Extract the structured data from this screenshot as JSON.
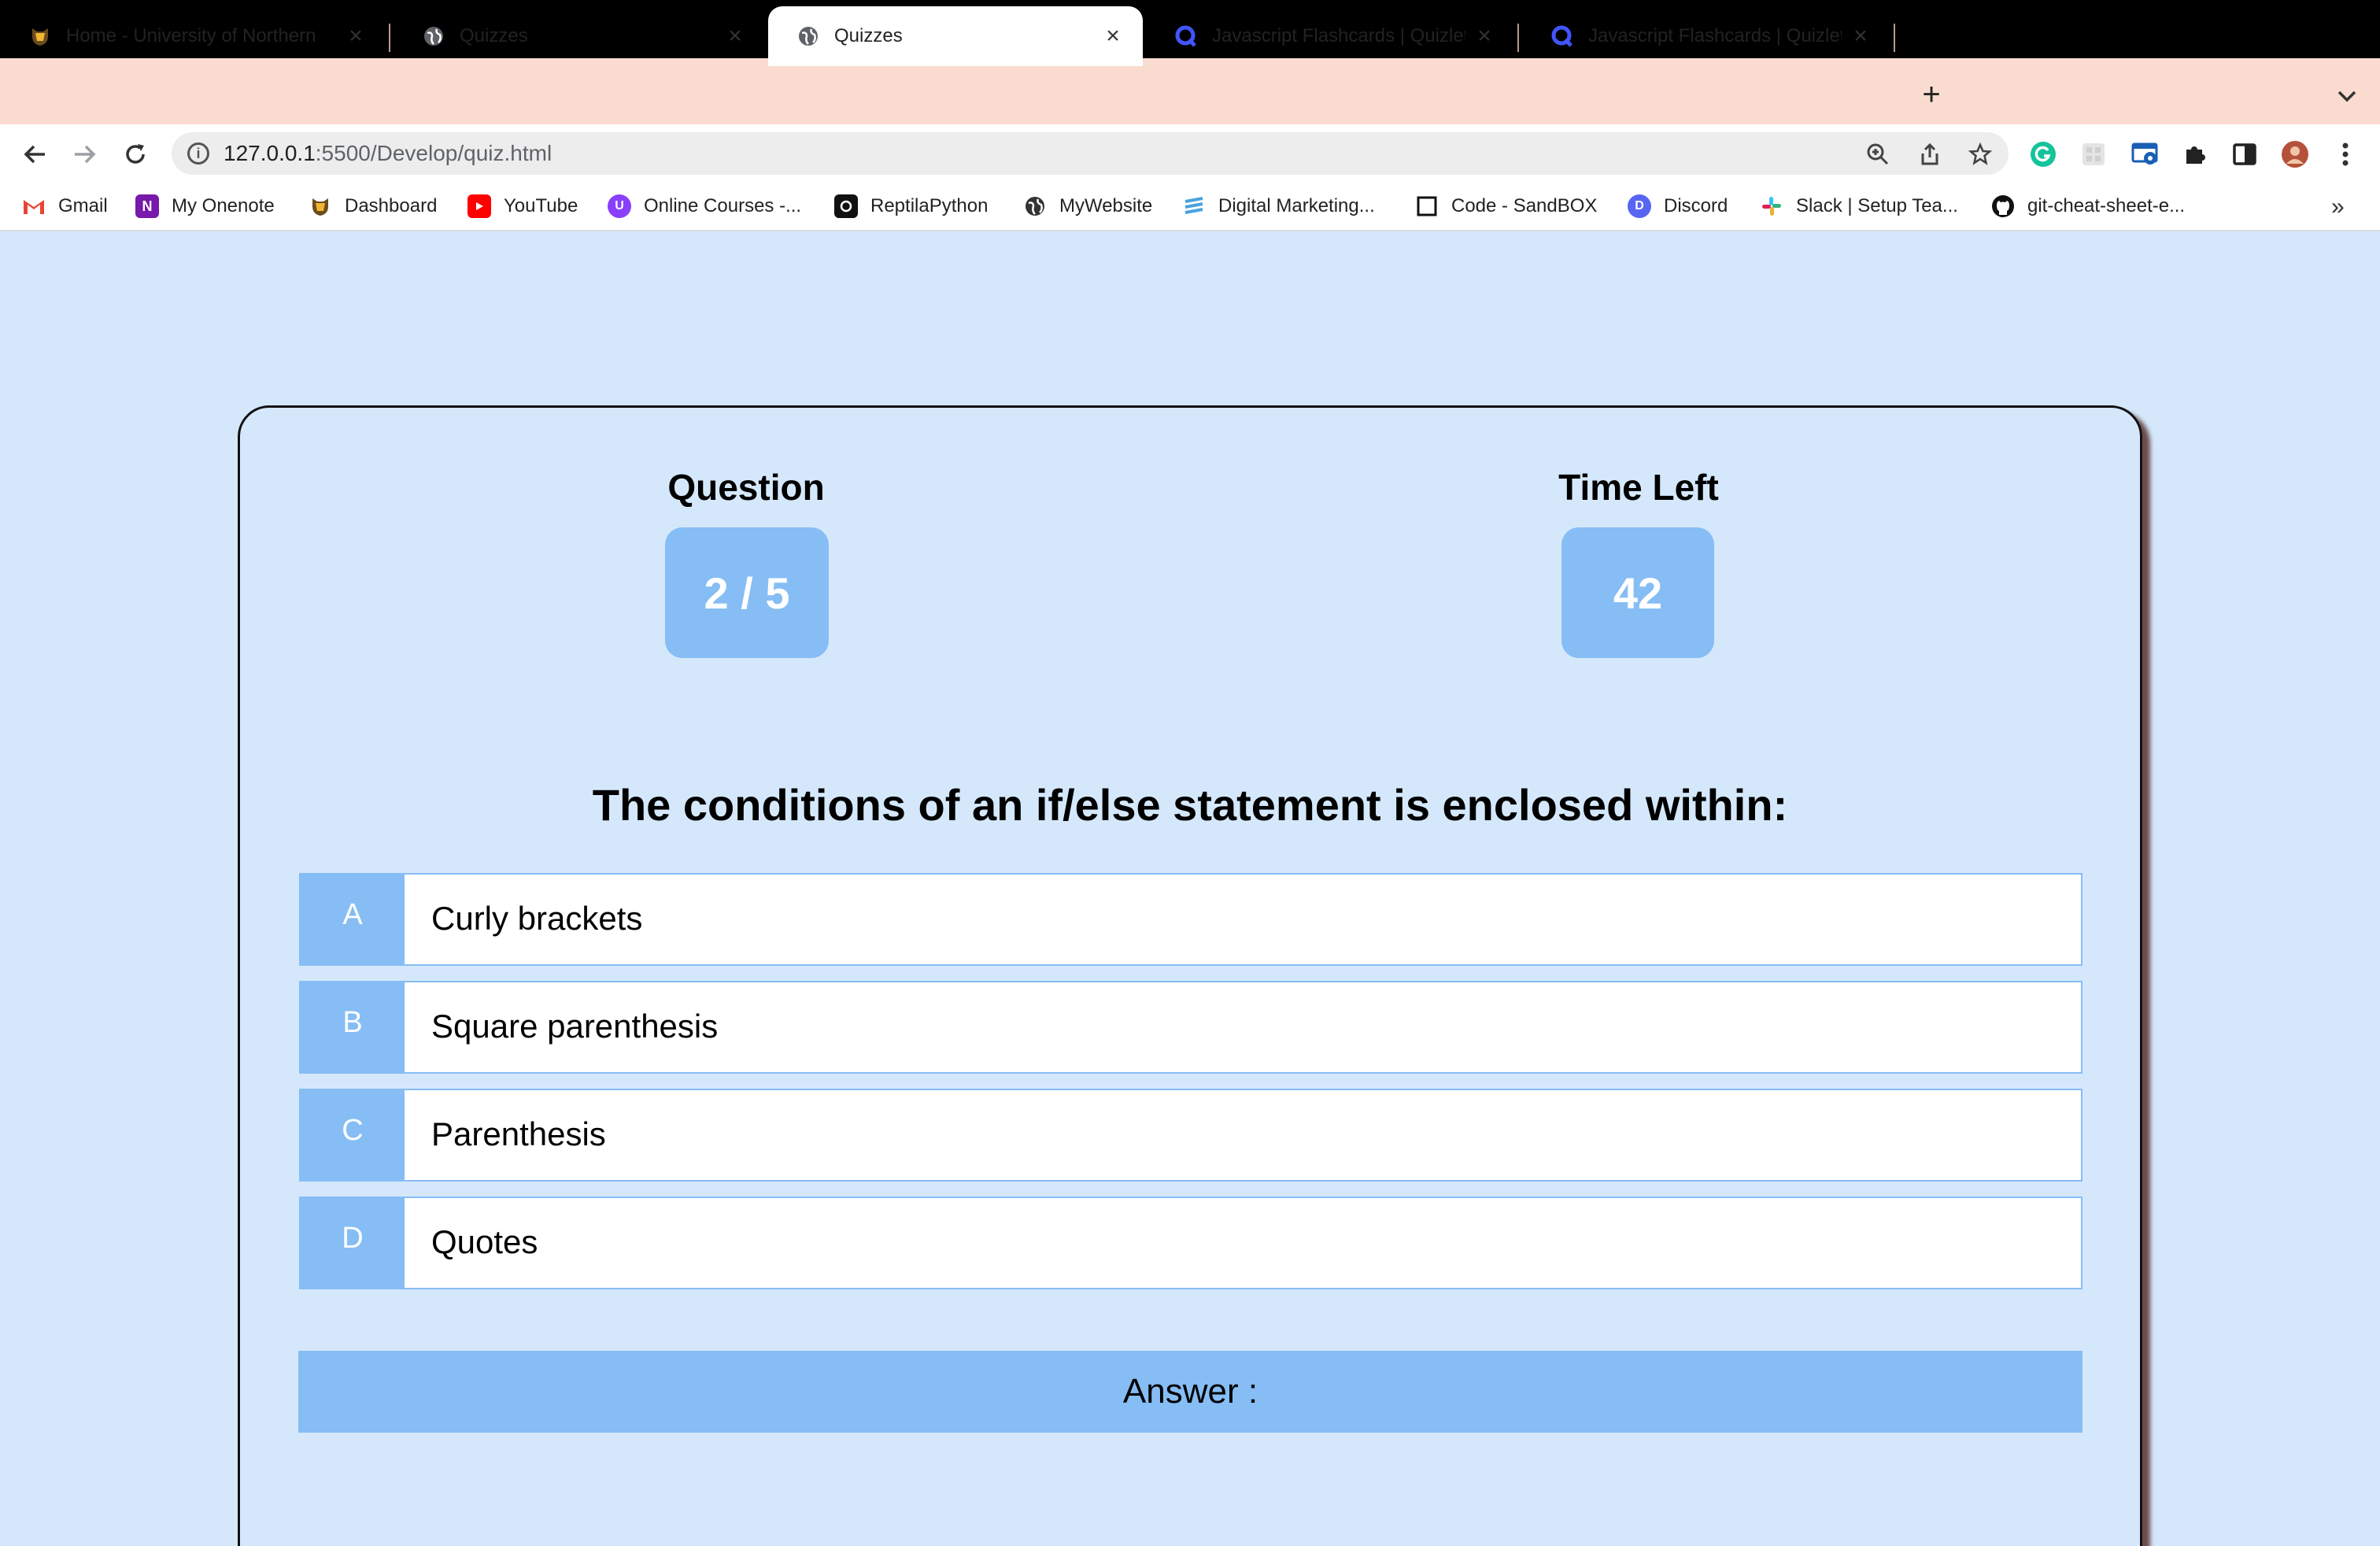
{
  "browser": {
    "tabs": [
      {
        "title": "Home - University of Northern",
        "favicon": "university-bear-icon"
      },
      {
        "title": "Quizzes",
        "favicon": "globe-icon"
      },
      {
        "title": "Quizzes",
        "favicon": "globe-icon",
        "active": true
      },
      {
        "title": "Javascript Flashcards | Quizlet",
        "favicon": "quizlet-icon"
      },
      {
        "title": "Javascript Flashcards | Quizlet",
        "favicon": "quizlet-icon"
      }
    ],
    "close_glyph": "×",
    "new_tab_glyph": "+",
    "url_host": "127.0.0.1",
    "url_rest": ":5500/Develop/quiz.html",
    "bookmarks": [
      {
        "label": "Gmail",
        "icon": "gmail-icon",
        "color": "#ea4335"
      },
      {
        "label": "My Onenote",
        "icon": "onenote-icon",
        "color": "#7719aa"
      },
      {
        "label": "Dashboard",
        "icon": "university-bear-icon",
        "color": "#6b4c1f"
      },
      {
        "label": "YouTube",
        "icon": "youtube-icon",
        "color": "#ff0000"
      },
      {
        "label": "Online Courses -...",
        "icon": "courses-icon",
        "color": "#8a3ffc"
      },
      {
        "label": "ReptilaPython",
        "icon": "reptila-icon",
        "color": "#111111"
      },
      {
        "label": "MyWebsite",
        "icon": "globe-icon",
        "color": "#333333"
      },
      {
        "label": "Digital Marketing...",
        "icon": "marketing-icon",
        "color": "#4aa3df"
      },
      {
        "label": "Code - SandBOX",
        "icon": "sandbox-icon",
        "color": "#111111"
      },
      {
        "label": "Discord",
        "icon": "discord-icon",
        "color": "#5865f2"
      },
      {
        "label": "Slack | Setup Tea...",
        "icon": "slack-icon",
        "color": "#e01e5a"
      },
      {
        "label": "git-cheat-sheet-e...",
        "icon": "github-icon",
        "color": "#111111"
      }
    ],
    "bookmarks_more": "»"
  },
  "quiz": {
    "question_label": "Question",
    "question_progress": "2 / 5",
    "time_label": "Time Left",
    "time_left": "42",
    "question_text": "The conditions of an if/else statement is enclosed within:",
    "options": [
      {
        "letter": "A",
        "text": "Curly brackets"
      },
      {
        "letter": "B",
        "text": "Square parenthesis"
      },
      {
        "letter": "C",
        "text": "Parenthesis"
      },
      {
        "letter": "D",
        "text": "Quotes"
      }
    ],
    "answer_label": "Answer :"
  },
  "colors": {
    "page_bg": "#d5e8fb",
    "accent": "#86bdf4",
    "tabstrip_bg": "#f9dccf"
  }
}
